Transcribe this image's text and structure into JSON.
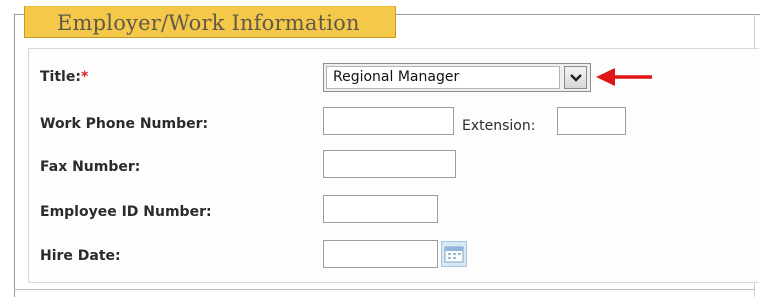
{
  "section": {
    "title": "Employer/Work Information"
  },
  "form": {
    "title": {
      "label": "Title:",
      "required_marker": "*",
      "selected": "Regional Manager"
    },
    "work_phone": {
      "label": "Work Phone Number:",
      "value": "",
      "extension_label": "Extension:",
      "extension_value": ""
    },
    "fax": {
      "label": "Fax Number:",
      "value": ""
    },
    "employee_id": {
      "label": "Employee ID Number:",
      "value": ""
    },
    "hire_date": {
      "label": "Hire Date:",
      "value": ""
    }
  },
  "icons": {
    "dropdown": "chevron-down-icon",
    "annotation": "red-arrow-left-icon",
    "calendar": "calendar-icon"
  },
  "colors": {
    "legend_bg": "#f5c84a",
    "required": "#d42020",
    "arrow": "#e01515"
  }
}
